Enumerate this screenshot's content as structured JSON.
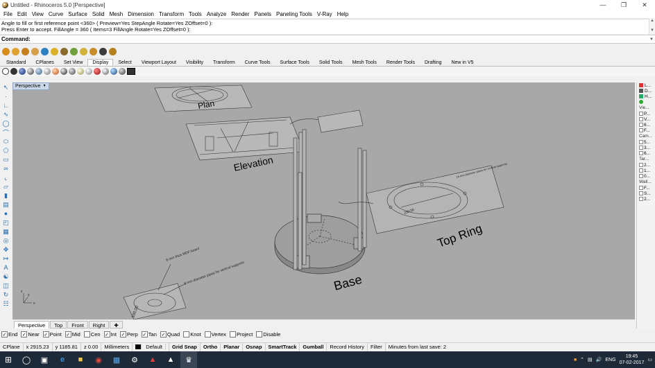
{
  "window": {
    "title": "Untitled - Rhinoceros 5.0 [Perspective]"
  },
  "menu": [
    "File",
    "Edit",
    "View",
    "Curve",
    "Surface",
    "Solid",
    "Mesh",
    "Dimension",
    "Transform",
    "Tools",
    "Analyze",
    "Render",
    "Panels",
    "Paneling Tools",
    "V-Ray",
    "Help"
  ],
  "command_history": {
    "line1": "Angle to fill or first reference point <360> ( Preview=Yes  StepAngle  Rotate=Yes  ZOffset=0 ):",
    "line2": "Press Enter to accept. FillAngle = 360 ( Items=3  FillAngle  Rotate=Yes  ZOffset=0 ):"
  },
  "command": {
    "label": "Command:",
    "value": ""
  },
  "toolbar_tabs": [
    "Standard",
    "CPlanes",
    "Set View",
    "Display",
    "Select",
    "Viewport Layout",
    "Visibility",
    "Transform",
    "Curve Tools",
    "Surface Tools",
    "Solid Tools",
    "Mesh Tools",
    "Render Tools",
    "Drafting",
    "New in V5"
  ],
  "active_toolbar_tab": "Display",
  "viewport": {
    "name": "Perspective",
    "labels": {
      "plan": "Plan",
      "elevation": "Elevation",
      "base": "Base",
      "top_ring": "Top Ring"
    },
    "notes": {
      "mdf": "8 mm thick MDF board",
      "pipes": "8 mm diameter pipes for vertical supports",
      "dim": "100.00",
      "ring_note": "16 mm diameter pipes for vertical supports",
      "ring_dim": "250.00"
    },
    "axes": {
      "x": "x",
      "y": "y",
      "z": "z"
    }
  },
  "viewport_tabs": [
    "Perspective",
    "Top",
    "Front",
    "Right"
  ],
  "osnaps": [
    {
      "label": "End",
      "checked": true
    },
    {
      "label": "Near",
      "checked": true
    },
    {
      "label": "Point",
      "checked": true
    },
    {
      "label": "Mid",
      "checked": true
    },
    {
      "label": "Cen",
      "checked": false
    },
    {
      "label": "Int",
      "checked": true
    },
    {
      "label": "Perp",
      "checked": true
    },
    {
      "label": "Tan",
      "checked": true
    },
    {
      "label": "Quad",
      "checked": true
    },
    {
      "label": "Knot",
      "checked": false
    },
    {
      "label": "Vertex",
      "checked": false
    },
    {
      "label": "Project",
      "checked": false
    },
    {
      "label": "Disable",
      "checked": false
    }
  ],
  "status": {
    "cplane": "CPlane",
    "x": "x 2915.23",
    "y": "y 1185.81",
    "z": "z 0.00",
    "units": "Millimeters",
    "layer": "Default",
    "grid_snap": "Grid Snap",
    "ortho": "Ortho",
    "planar": "Planar",
    "osnap": "Osnap",
    "smarttrack": "SmartTrack",
    "gumball": "Gumball",
    "record_history": "Record History",
    "filter": "Filter",
    "last_save": "Minutes from last save: 2"
  },
  "right_panel": {
    "top": [
      {
        "label": "L...",
        "color": "#d33"
      },
      {
        "label": "D...",
        "color": "#555"
      },
      {
        "label": "H...",
        "color": "#2a6"
      }
    ],
    "view_header": "Vie...",
    "view_items": [
      "P...",
      "V...",
      "6...",
      "F..."
    ],
    "camera_header": "Cam...",
    "camera_items": [
      "5...",
      "3...",
      "6..."
    ],
    "target_header": "Tar...",
    "target_items": [
      "2...",
      "1...",
      "0..."
    ],
    "wall_header": "Wall...",
    "wall_items": [
      "F...",
      "S...",
      "2..."
    ]
  },
  "taskbar": {
    "lang": "ENG",
    "time": "19:45",
    "date": "07-02-2017"
  }
}
